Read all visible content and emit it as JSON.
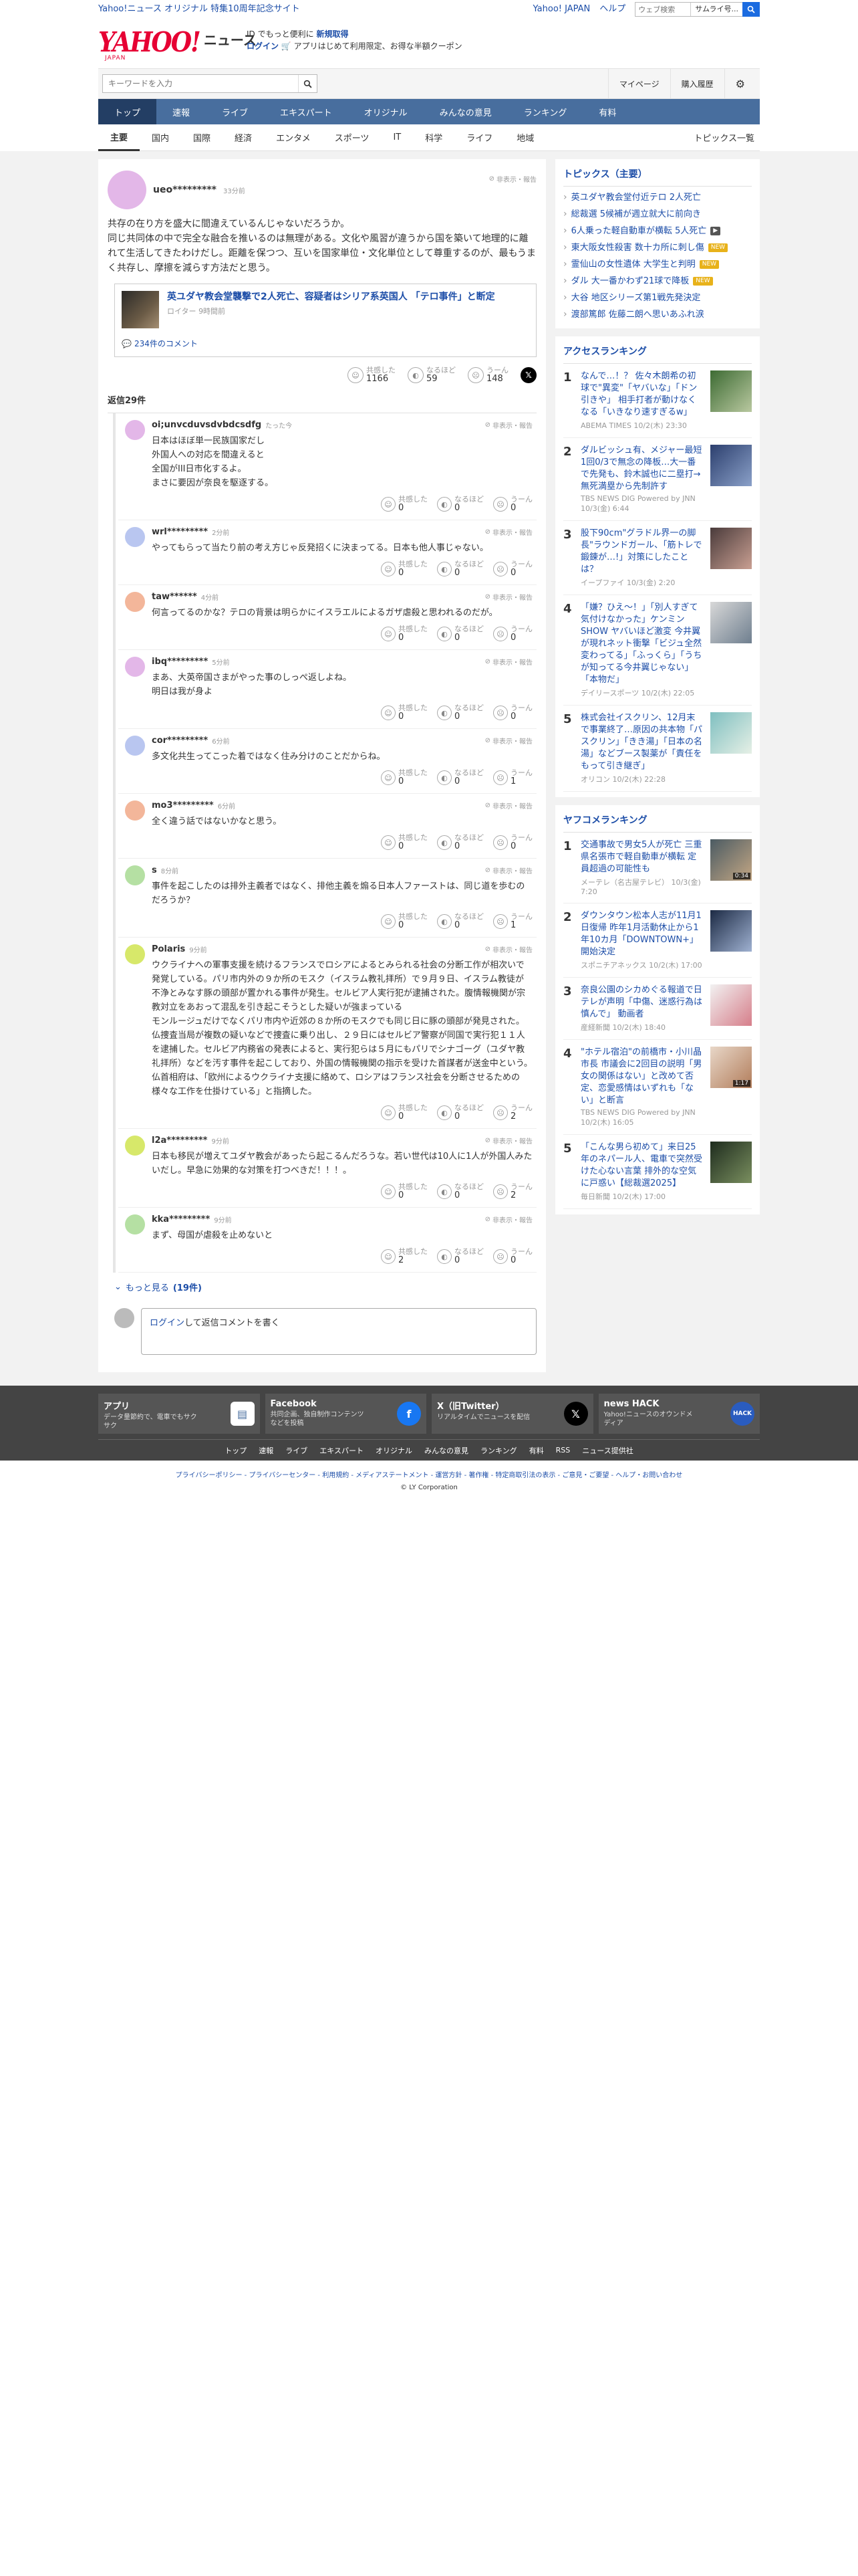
{
  "top": {
    "left_link": "Yahoo!ニュース オリジナル 特集10周年記念サイト",
    "links": [
      "Yahoo! JAPAN",
      "ヘルプ"
    ],
    "search_placeholder": "ウェブ検索",
    "search_scope": "サムライ号..."
  },
  "masthead": {
    "logo": "YAHOO!",
    "logo_sub": "JAPAN",
    "news": "ニュース",
    "promo_line1": "ID でもっと便利に",
    "promo_line1_link": "新規取得",
    "promo_login": "ログイン",
    "promo_line2": "アプリはじめて利用限定、お得な半額クーポン"
  },
  "searchbar": {
    "placeholder": "キーワードを入力",
    "mypage": "マイページ",
    "purchase": "購入履歴"
  },
  "nav": {
    "items": [
      "トップ",
      "速報",
      "ライブ",
      "エキスパート",
      "オリジナル",
      "みんなの意見",
      "ランキング",
      "有料"
    ]
  },
  "subnav": {
    "items": [
      "主要",
      "国内",
      "国際",
      "経済",
      "エンタメ",
      "スポーツ",
      "IT",
      "科学",
      "ライフ",
      "地域"
    ],
    "all": "トピックス一覧"
  },
  "main_comment": {
    "user": "ueo*********",
    "time": "33分前",
    "hide_label": "非表示・報告",
    "text": "共存の在り方を盛大に間違えているんじゃないだろうか。\n同じ共同体の中で完全な融合を推いるのは無理がある。文化や風習が違うから国を築いて地理的に離れて生活してきたわけだし。距離を保つつ、互いを国家単位・文化単位として尊重するのが、最もうまく共存し、摩擦を減らす方法だと思う。",
    "article_title": "英ユダヤ教会堂襲撃で2人死亡、容疑者はシリア系英国人 「テロ事件」と断定",
    "article_source": "ロイター",
    "article_time": "9時間前",
    "comment_count": "234件のコメント",
    "reactions": {
      "kyokan": "1166",
      "naruhodo": "59",
      "uun": "148"
    },
    "labels": {
      "kyokan": "共感した",
      "naruhodo": "なるほど",
      "uun": "うーん"
    }
  },
  "replies_header": "返信29件",
  "replies": [
    {
      "user": "oi;unvcduvsdvbdcsdfg",
      "time": "たった今",
      "text": "日本はほぼ単一民族国家だし\n外国人への対応を間違えると\n全国がIII日市化するよ。\nまさに要因が奈良を駆逐する。",
      "k": "0",
      "n": "0",
      "u": "0",
      "color": "#e3b7e8"
    },
    {
      "user": "wrl*********",
      "time": "2分前",
      "text": "やってもらって当たり前の考え方じゃ反発招くに決まってる。日本も他人事じゃない。",
      "k": "0",
      "n": "0",
      "u": "0",
      "color": "#b9c6f0"
    },
    {
      "user": "taw******",
      "time": "4分前",
      "text": "何言ってるのかな？テロの背景は明らかにイスラエルによるガザ虐殺と思われるのだが。",
      "k": "0",
      "n": "0",
      "u": "0",
      "color": "#f3b69a"
    },
    {
      "user": "ibq*********",
      "time": "5分前",
      "text": "まあ、大英帝国さまがやった事のしっぺ返しよね。\n明日は我が身よ",
      "k": "0",
      "n": "0",
      "u": "0",
      "color": "#e3b7e8"
    },
    {
      "user": "cor*********",
      "time": "6分前",
      "text": "多文化共生ってこった着ではなく住み分けのことだからね。",
      "k": "0",
      "n": "0",
      "u": "1",
      "color": "#b9c6f0"
    },
    {
      "user": "mo3*********",
      "time": "6分前",
      "text": "全く違う話ではないかなと思う。",
      "k": "0",
      "n": "0",
      "u": "0",
      "color": "#f3b69a"
    },
    {
      "user": "s",
      "time": "8分前",
      "text": "事件を起こしたのは排外主義者ではなく、排他主義を煽る日本人ファーストは、同じ道を歩むのだろうか？",
      "k": "0",
      "n": "0",
      "u": "1",
      "color": "#b5e0a3"
    },
    {
      "user": "Polaris",
      "time": "9分前",
      "text": "ウクライナへの軍事支援を続けるフランスでロシアによるとみられる社会の分断工作が相次いで発覚している。パリ市内外の９か所のモスク（イスラム教礼拝所）で９月９日、イスラム教徒が不浄とみなす豚の頭部が置かれる事件が発生。セルビア人実行犯が逮捕された。腹情報機関が宗教対立をあおって混乱を引き起こそうとした疑いが強まっている\nモンルージュだけでなくパリ市内や近郊の８か所のモスクでも同じ日に豚の頭部が発見された。仏捜査当局が複数の疑いなどで捜査に乗り出し、２９日にはセルビア警察が同国で実行犯１１人を逮捕した。セルビア内務省の発表によると、実行犯らは５月にもパリでシナゴーグ（ユダヤ教礼拝所）などを汚す事件を起こしており、外国の情報機関の指示を受けた首謀者が送金中という。\n仏首相府は、「欧州によるウクライナ支援に絡めて、ロシアはフランス社会を分断させるための様々な工作を仕掛けている」と指摘した。",
      "k": "0",
      "n": "0",
      "u": "2",
      "color": "#d7e86a"
    },
    {
      "user": "l2a*********",
      "time": "9分前",
      "text": "日本も移民が増えてユダヤ教会があったら起こるんだろうな。若い世代は10人に1人が外国人みたいだし。早急に効果的な対策を打つべきだ！！！。",
      "k": "0",
      "n": "0",
      "u": "2",
      "color": "#d7e86a"
    },
    {
      "user": "kka*********",
      "time": "9分前",
      "text": "まず、母国が虐殺を止めないと",
      "k": "2",
      "n": "0",
      "u": "0",
      "color": "#b5e0a3"
    }
  ],
  "more_label": "もっと見る",
  "more_count": "(19件)",
  "login_prompt_link": "ログイン",
  "login_prompt_rest": "して返信コメントを書く",
  "topics": {
    "title": "トピックス（主要）",
    "items": [
      {
        "text": "英ユダヤ教会堂付近テロ 2人死亡",
        "tag": ""
      },
      {
        "text": "総裁選 5候補が週立就大に前向き",
        "tag": ""
      },
      {
        "text": "6人乗った軽自動車が横転 5人死亡",
        "tag": "cam"
      },
      {
        "text": "東大阪女性殺害 数十カ所に刺し傷",
        "tag": "new"
      },
      {
        "text": "霊仙山の女性遺体 大学生と判明",
        "tag": "new"
      },
      {
        "text": "ダル 大一番かわず21球で降板",
        "tag": "new"
      },
      {
        "text": "大谷 地区シリーズ第1戦先発決定",
        "tag": ""
      },
      {
        "text": "渡部篤郎 佐藤二朗へ思いあふれ涙",
        "tag": ""
      }
    ],
    "cam_label": "▶",
    "new_label": "NEW"
  },
  "access": {
    "title": "アクセスランキング",
    "items": [
      {
        "n": "1",
        "t": "なんで…！？ 佐々木朗希の初球で\"異変\"「ヤバいな」「ドン引きや」 相手打者が動けなくなる「いきなり速すぎるw」",
        "s": "ABEMA TIMES 10/2(木) 23:30"
      },
      {
        "n": "2",
        "t": "ダルビッシュ有、メジャー最短1回0/3で無念の降板…大一番で先発も、鈴木誠也に二塁打→無死満塁から先制許す",
        "s": "TBS NEWS DIG Powered by JNN 10/3(金) 6:44"
      },
      {
        "n": "3",
        "t": "股下90cm\"グラドル界一の脚長\"ラウンドガール、「筋トレで鍛錬が…!」対策にしたことは？",
        "s": "イープファイ 10/3(金) 2:20"
      },
      {
        "n": "4",
        "t": "「嫌？ひえ～！」「別人すぎて気付けなかった」ケンミンSHOW ヤバいほど激変 今井翼が現れネット衝撃「ビジュ全然変わってる」「ふっくら」「うちが知ってる今井翼じゃない」「本物だ」",
        "s": "デイリースポーツ 10/2(木) 22:05"
      },
      {
        "n": "5",
        "t": "株式会社イスクリン、12月末で事業終了…原因の共本物「パスクリン」「きき湯」「日本の名湯」などブース製薬が「責任をもって引き継ぎ」",
        "s": "オリコン 10/2(木) 22:28"
      }
    ]
  },
  "yafuko": {
    "title": "ヤフコメランキング",
    "items": [
      {
        "n": "1",
        "t": "交通事故で男女5人が死亡 三重県名張市で軽自動車が横転 定員超過の可能性も",
        "s": "メーテレ（名古屋テレビ） 10/3(金) 7:20",
        "dur": "0:34"
      },
      {
        "n": "2",
        "t": "ダウンタウン松本人志が11月1日復帰 昨年1月活動休止から1年10カ月「DOWNTOWN+」開始決定",
        "s": "スポニチアネックス 10/2(木) 17:00",
        "dur": ""
      },
      {
        "n": "3",
        "t": "奈良公園のシカめぐる報道で日テレが声明「中傷、迷惑行為は慎んで」 動画者",
        "s": "産経新聞 10/2(木) 18:40",
        "dur": ""
      },
      {
        "n": "4",
        "t": "\"ホテル宿泊\"の前橋市・小川晶市長 市議会に2回目の説明「男女の関係はない」と改めて否定、恋愛感情はいずれも「ない」と断言",
        "s": "TBS NEWS DIG Powered by JNN 10/2(木) 16:05",
        "dur": "1:17"
      },
      {
        "n": "5",
        "t": "「こんな男ら初めて」来日25年のネパール人、電車で突然受けた心ない言葉 排外的な空気に戸惑い【総裁選2025】",
        "s": "毎日新聞 10/2(木) 17:00",
        "dur": ""
      }
    ]
  },
  "footer": {
    "cards": [
      {
        "title": "アプリ",
        "desc": "データ量節約で、電車でもサクサク"
      },
      {
        "title": "Facebook",
        "desc": "共同企画、独自制作コンテンツなどを投稿"
      },
      {
        "title": "X（旧Twitter）",
        "desc": "リアルタイムでニュースを配信"
      },
      {
        "title": "news HACK",
        "desc": "Yahoo!ニュースのオウンドメディア"
      }
    ],
    "links": [
      "トップ",
      "速報",
      "ライブ",
      "エキスパート",
      "オリジナル",
      "みんなの意見",
      "ランキング",
      "有料",
      "RSS",
      "ニュース提供社"
    ],
    "legal": "プライバシーポリシー - プライバシーセンター - 利用規約 - メディアステートメント - 運営方針 - 著作権 - 特定商取引法の表示 - ご意見・ご要望 - ヘルプ・お問い合わせ",
    "copyright": "© LY Corporation"
  },
  "colors": {
    "brand": "#e60033",
    "nav": "#486e9e",
    "nav_active": "#233e64",
    "link": "#1d4ea8"
  }
}
